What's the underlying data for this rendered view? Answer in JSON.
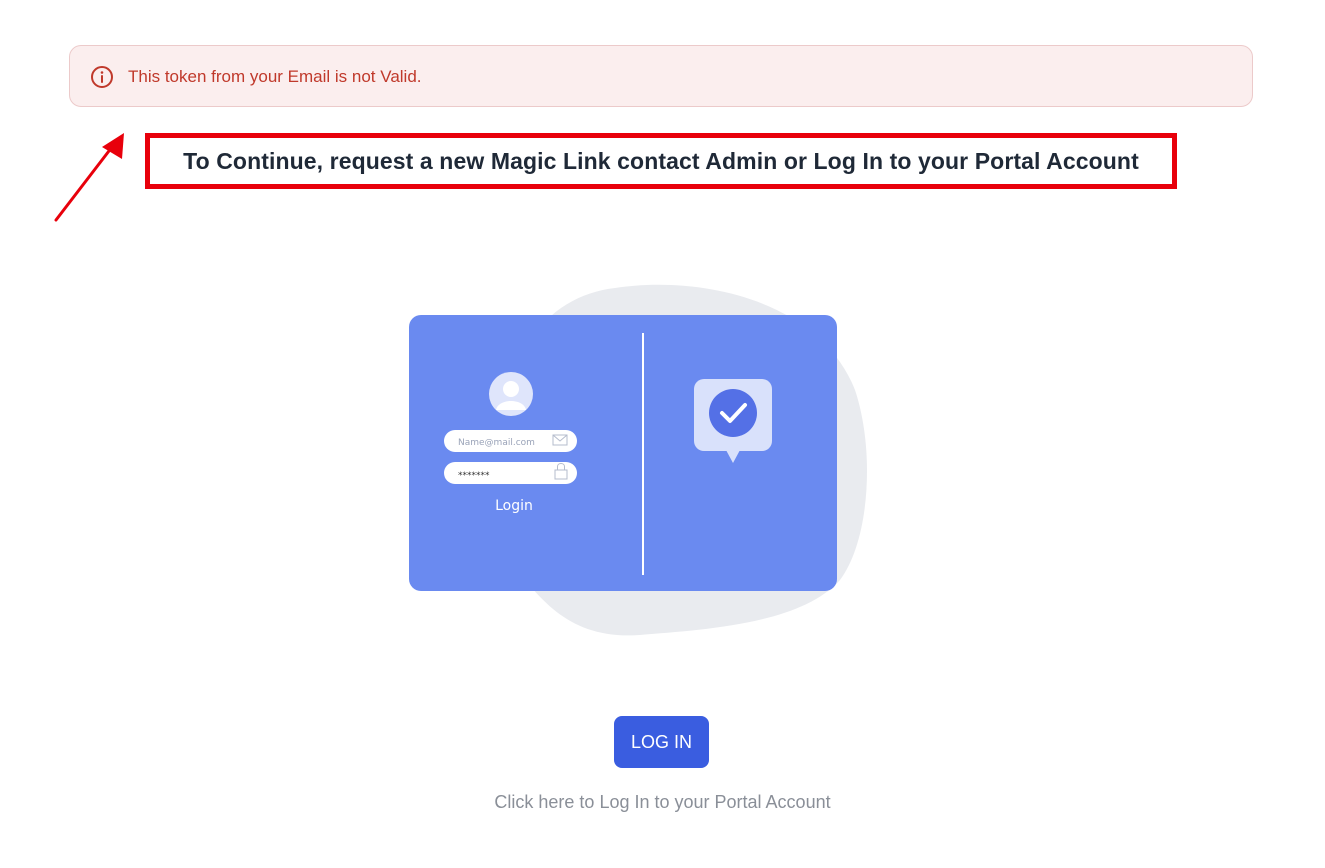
{
  "alert": {
    "icon": "info-circle-icon",
    "message": "This token from your Email is not Valid.",
    "color": "#c0392b",
    "background": "#fbeeee"
  },
  "annotation": {
    "instruction": "To Continue, request a new Magic Link contact Admin or Log In to your Portal Account",
    "box_color": "#e8000b",
    "arrow_icon": "arrow-up-right-icon"
  },
  "illustration": {
    "email_placeholder": "Name@mail.com",
    "password_mask": "*******",
    "login_label": "Login",
    "avatar_icon": "user-avatar-icon",
    "mail_icon": "envelope-icon",
    "lock_icon": "lock-icon",
    "check_icon": "check-bubble-icon",
    "card_color": "#6a8af0"
  },
  "login": {
    "button_label": "LOG IN",
    "caption": "Click here to Log In to your Portal Account",
    "button_color": "#3a5de0"
  }
}
